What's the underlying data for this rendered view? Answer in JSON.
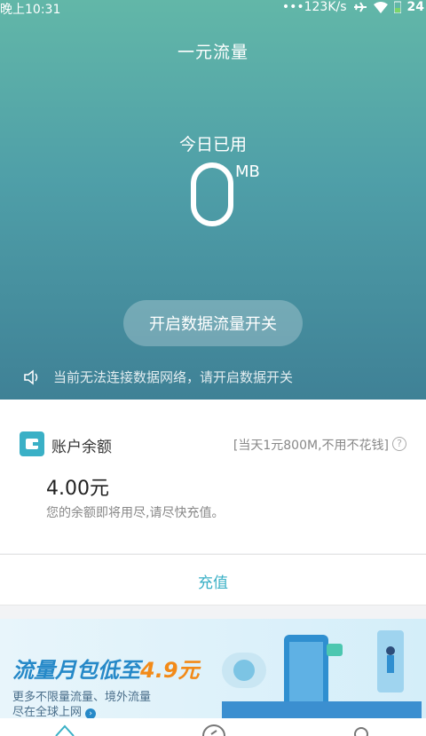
{
  "status_bar": {
    "time": "晚上10:31",
    "network_speed": "•••123K/s",
    "battery": "24"
  },
  "header": {
    "title": "一元流量"
  },
  "usage": {
    "label": "今日已用",
    "value": "0",
    "unit": "MB"
  },
  "toggle_button": {
    "label": "开启数据流量开关"
  },
  "notice": {
    "text": "当前无法连接数据网络，请开启数据开关"
  },
  "balance_card": {
    "title": "账户余额",
    "promo": "[当天1元800M,不用不花钱]",
    "help": "?",
    "amount": "4.00元",
    "note": "您的余额即将用尽,请尽快充值。"
  },
  "recharge": {
    "label": "充值"
  },
  "banner": {
    "title_main": "流量月包低至",
    "title_price": "4.9元",
    "sub_line1": "更多不限量流量、境外流量",
    "sub_line2": "尽在全球上网"
  },
  "colors": {
    "accent": "#3ab0c6",
    "hero_top": "#62b7a8",
    "hero_bottom": "#3f8196",
    "banner_title": "#2689c8",
    "banner_price": "#f28a18"
  },
  "icons": [
    "airplane-icon",
    "wifi-icon",
    "battery-icon",
    "speaker-icon",
    "wallet-icon",
    "help-icon",
    "home-tab-icon",
    "discover-tab-icon",
    "profile-tab-icon"
  ]
}
